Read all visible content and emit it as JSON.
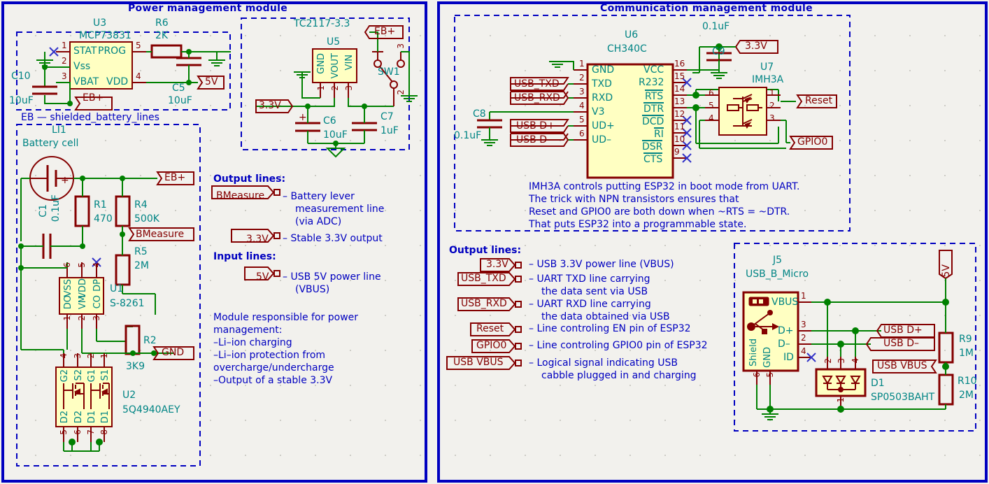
{
  "sheet": {
    "background": "#f2f1ed",
    "frame_color": "#0000c0",
    "wire_color": "#008000",
    "component_color": "#840000",
    "label_color": "#008484"
  },
  "modules": [
    {
      "id": "power",
      "title": "Power management module",
      "subsections": [
        {
          "id": "charger",
          "caption": ""
        },
        {
          "id": "eb",
          "caption": "EB — shielded_battery_lines"
        },
        {
          "id": "ldo",
          "caption": ""
        }
      ]
    },
    {
      "id": "comm",
      "title": "Communication management module",
      "subsections": [
        {
          "id": "uart",
          "caption": ""
        },
        {
          "id": "usb",
          "caption": ""
        }
      ]
    }
  ],
  "power_module": {
    "charger": {
      "ic": {
        "ref": "U3",
        "value": "MCP73831",
        "pins": [
          {
            "num": "1",
            "name": "STAT",
            "side": "left"
          },
          {
            "num": "2",
            "name": "Vss",
            "side": "left"
          },
          {
            "num": "3",
            "name": "VBAT",
            "side": "left"
          },
          {
            "num": "5",
            "name": "PROG",
            "side": "right"
          },
          {
            "num": "4",
            "name": "VDD",
            "side": "right"
          }
        ]
      },
      "parts": [
        {
          "ref": "C10",
          "value": "10uF",
          "type": "capacitor"
        },
        {
          "ref": "R6",
          "value": "2K",
          "type": "resistor"
        },
        {
          "ref": "C5",
          "value": "10uF",
          "type": "capacitor"
        }
      ],
      "net_labels": [
        {
          "name": "EB+"
        },
        {
          "name": "5V"
        }
      ]
    },
    "ldo": {
      "ic": {
        "ref": "U5",
        "value": "TC2117-3.3",
        "pins": [
          {
            "num": "1",
            "name": "GND"
          },
          {
            "num": "2",
            "name": "VOUT"
          },
          {
            "num": "3",
            "name": "VIN"
          }
        ]
      },
      "switch": {
        "ref": "SW1",
        "pins": [
          "1",
          "2",
          "3"
        ]
      },
      "parts": [
        {
          "ref": "C6",
          "value": "10uF",
          "type": "capacitor-polarized"
        },
        {
          "ref": "C7",
          "value": "1uF",
          "type": "capacitor"
        }
      ],
      "net_labels": [
        {
          "name": "EB+"
        },
        {
          "name": "3.3V"
        }
      ]
    },
    "battery": {
      "caption": "EB — shielded_battery_lines",
      "cell": {
        "ref": "LI1",
        "value": "Battery cell"
      },
      "parts": [
        {
          "ref": "C1",
          "value": "0.1uF",
          "type": "capacitor"
        },
        {
          "ref": "R1",
          "value": "470",
          "type": "resistor"
        },
        {
          "ref": "R4",
          "value": "500K",
          "type": "resistor"
        },
        {
          "ref": "R5",
          "value": "2M",
          "type": "resistor"
        },
        {
          "ref": "R2",
          "value": "3K9",
          "type": "resistor"
        }
      ],
      "protection_ic": {
        "ref": "U1",
        "value": "S-8261",
        "top_pins": [
          {
            "num": "6",
            "name": "DO VSS"
          },
          {
            "num": "5",
            "name": "VM VDD"
          },
          {
            "num": "4",
            "name": "CO DP"
          }
        ],
        "bottom_pins": [
          {
            "num": "1",
            "name": ""
          },
          {
            "num": "2",
            "name": ""
          },
          {
            "num": "3",
            "name": ""
          }
        ],
        "labels_row1": [
          "DO",
          "VSS",
          "VM",
          "VDD",
          "CO",
          "DP"
        ]
      },
      "mosfet_ic": {
        "ref": "U2",
        "value": "5Q4940AEY",
        "top_pins": [
          {
            "num": "4",
            "name": "G2"
          },
          {
            "num": "3",
            "name": "S2"
          },
          {
            "num": "2",
            "name": "G1"
          },
          {
            "num": "1",
            "name": "S1"
          }
        ],
        "bottom_pins": [
          {
            "num": "5",
            "name": "D2"
          },
          {
            "num": "6",
            "name": "D2"
          },
          {
            "num": "7",
            "name": "D1"
          },
          {
            "num": "8",
            "name": "D1"
          }
        ]
      },
      "net_labels": [
        {
          "name": "EB+"
        },
        {
          "name": "BMeasure"
        },
        {
          "name": "GND"
        }
      ]
    },
    "legend": {
      "output_heading": "Output lines:",
      "output_items": [
        {
          "label": "BMeasure",
          "desc": [
            "– Battery lever",
            "measurement line",
            "(via ADC)"
          ]
        },
        {
          "label": "3.3V",
          "desc": [
            "– Stable 3.3V output"
          ]
        }
      ],
      "input_heading": "Input lines:",
      "input_items": [
        {
          "label": "5V",
          "desc": [
            "– USB 5V power line",
            "(VBUS)"
          ]
        }
      ],
      "description": [
        "Module responsible for power",
        "management:",
        "–Li–ion charging",
        "–Li–ion protection from",
        "  overcharge/undercharge",
        "–Output of a stable 3.3V"
      ]
    }
  },
  "comm_module": {
    "uart": {
      "ic": {
        "ref": "U6",
        "value": "CH340C",
        "left_pins": [
          {
            "num": "1",
            "name": "GND"
          },
          {
            "num": "2",
            "name": "TXD"
          },
          {
            "num": "3",
            "name": "RXD"
          },
          {
            "num": "4",
            "name": "V3"
          },
          {
            "num": "5",
            "name": "UD+"
          },
          {
            "num": "6",
            "name": "UD–"
          }
        ],
        "right_pins": [
          {
            "num": "16",
            "name": "VCC",
            "bar": false
          },
          {
            "num": "15",
            "name": "R232",
            "bar": false
          },
          {
            "num": "14",
            "name": "RTS",
            "bar": true
          },
          {
            "num": "13",
            "name": "DTR",
            "bar": true
          },
          {
            "num": "12",
            "name": "DCD",
            "bar": true
          },
          {
            "num": "11",
            "name": "RI",
            "bar": true
          },
          {
            "num": "10",
            "name": "DSR",
            "bar": true
          },
          {
            "num": "9",
            "name": "CTS",
            "bar": true
          }
        ]
      },
      "parts": [
        {
          "ref": "C8",
          "value": "0.1uF",
          "type": "capacitor"
        },
        {
          "ref": "C9",
          "value": "0.1uF",
          "type": "capacitor"
        }
      ],
      "transistor_array": {
        "ref": "U7",
        "value": "IMH3A",
        "left_pins": [
          "6",
          "5",
          "4"
        ],
        "right_pins": [
          "1",
          "2",
          "3"
        ]
      },
      "net_labels": [
        {
          "name": "USB_TXD"
        },
        {
          "name": "USB_RXD"
        },
        {
          "name": "USB D+"
        },
        {
          "name": "USB D–"
        },
        {
          "name": "3.3V"
        },
        {
          "name": "Reset"
        },
        {
          "name": "GPIO0"
        }
      ],
      "note": [
        "IMH3A controls putting ESP32 in boot mode from UART.",
        "The trick with NPN transistors ensures that",
        "Reset and GPIO0 are both down when ~RTS = ~DTR.",
        "That puts ESP32 into a programmable state."
      ]
    },
    "usb": {
      "connector": {
        "ref": "J5",
        "value": "USB_B_Micro",
        "pins": [
          {
            "num": "1",
            "name": "VBUS"
          },
          {
            "num": "3",
            "name": "D+"
          },
          {
            "num": "2",
            "name": "D–"
          },
          {
            "num": "4",
            "name": "ID"
          },
          {
            "num": "6",
            "name": "Shield"
          },
          {
            "num": "5",
            "name": "GND"
          }
        ]
      },
      "tvs": {
        "ref": "D1",
        "value": "SP0503BAHT",
        "pins": [
          "2",
          "3",
          "4",
          "1"
        ]
      },
      "parts": [
        {
          "ref": "R9",
          "value": "1M",
          "type": "resistor"
        },
        {
          "ref": "R10",
          "value": "2M",
          "type": "resistor"
        }
      ],
      "net_labels": [
        {
          "name": "5V"
        },
        {
          "name": "USB D+"
        },
        {
          "name": "USB D–"
        },
        {
          "name": "USB VBUS"
        }
      ]
    },
    "legend": {
      "output_heading": "Output lines:",
      "output_items": [
        {
          "label": "3.3V",
          "desc": [
            "– USB 3.3V power line (VBUS)"
          ]
        },
        {
          "label": "USB_TXD",
          "desc": [
            "– UART TXD line carrying",
            "the data sent via USB"
          ]
        },
        {
          "label": "USB_RXD",
          "desc": [
            "– UART RXD line carrying",
            "the data obtained via USB"
          ]
        },
        {
          "label": "Reset",
          "desc": [
            "– Line controling EN pin of ESP32"
          ]
        },
        {
          "label": "GPIO0",
          "desc": [
            "– Line controling GPIO0 pin of ESP32"
          ]
        },
        {
          "label": "USB VBUS",
          "desc": [
            "– Logical signal indicating USB",
            "cabble plugged in and charging"
          ]
        }
      ]
    }
  }
}
